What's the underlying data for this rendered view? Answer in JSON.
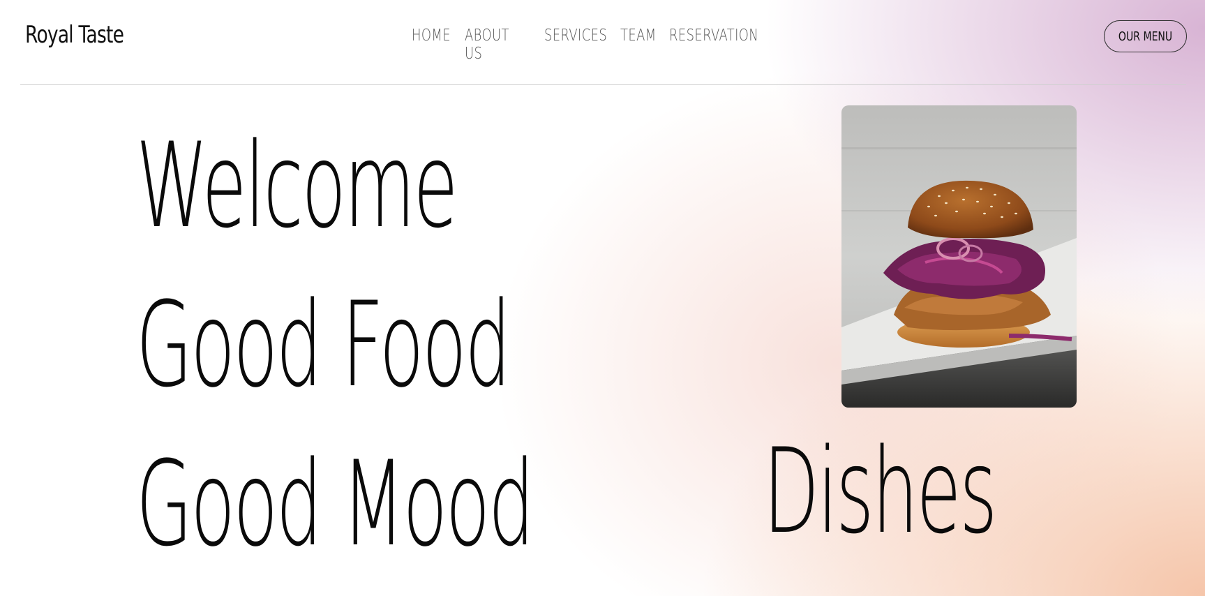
{
  "brand": {
    "name": "Royal Taste"
  },
  "nav": {
    "items": [
      "HOME",
      "ABOUT US",
      "SERVICES",
      "TEAM",
      "RESERVATION"
    ]
  },
  "header": {
    "menu_button_label": "OUR MENU"
  },
  "hero": {
    "lines": [
      "Welcome",
      "Good Food",
      "Good Mood"
    ],
    "side_word": "Dishes"
  },
  "image": {
    "subject": "burger-photo"
  },
  "colors": {
    "gradient_top_right": "#d6b0d2",
    "gradient_bottom_right": "#f5c4a8",
    "text": "#0a0a0a",
    "nav_text": "#555555"
  }
}
